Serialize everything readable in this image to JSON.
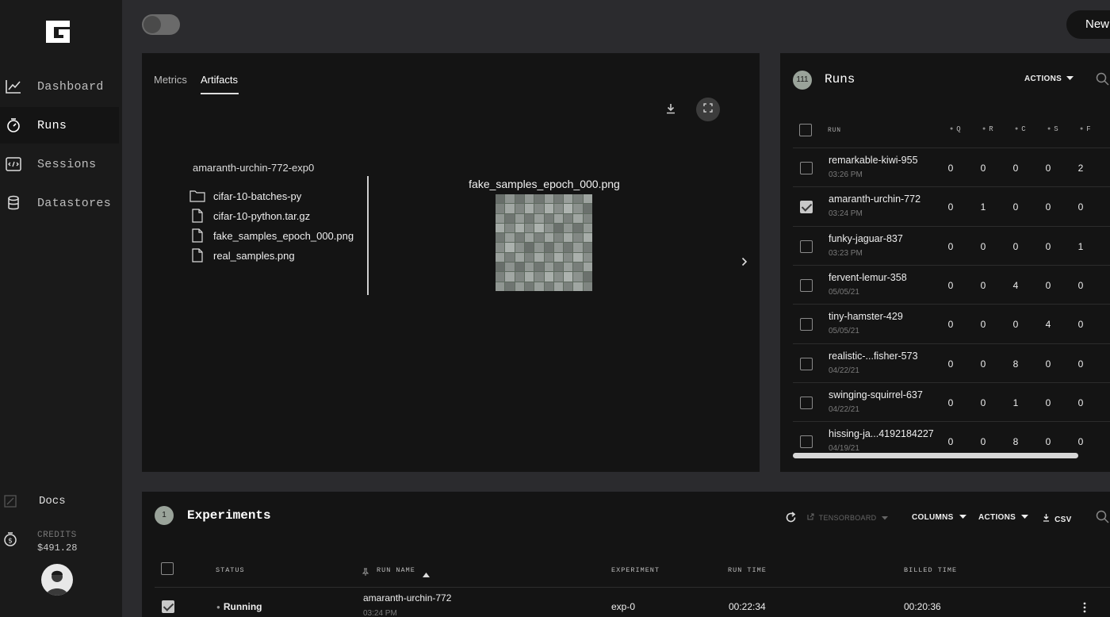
{
  "sidebar": {
    "items": [
      {
        "label": "Dashboard",
        "icon": "chart-line-icon",
        "active": false
      },
      {
        "label": "Runs",
        "icon": "stopwatch-icon",
        "active": true
      },
      {
        "label": "Sessions",
        "icon": "code-window-icon",
        "active": false
      },
      {
        "label": "Datastores",
        "icon": "database-icon",
        "active": false
      }
    ],
    "docs_label": "Docs",
    "credits_label": "CREDITS",
    "credits_value": "$491.28"
  },
  "topbar": {
    "new_label": "New"
  },
  "artifacts": {
    "tabs": [
      "Metrics",
      "Artifacts"
    ],
    "active_tab": "Artifacts",
    "tree_root": "amaranth-urchin-772-exp0",
    "files": [
      {
        "name": "cifar-10-batches-py",
        "type": "folder"
      },
      {
        "name": "cifar-10-python.tar.gz",
        "type": "file"
      },
      {
        "name": "fake_samples_epoch_000.png",
        "type": "file"
      },
      {
        "name": "real_samples.png",
        "type": "file"
      }
    ],
    "preview_title": "fake_samples_epoch_000.png"
  },
  "runs": {
    "count": "111",
    "title": "Runs",
    "actions_label": "ACTIONS",
    "headers": {
      "run": "RUN",
      "cols": [
        "Q",
        "R",
        "C",
        "S",
        "F"
      ]
    },
    "rows": [
      {
        "name": "remarkable-kiwi-955",
        "time": "03:26 PM",
        "checked": false,
        "vals": [
          "0",
          "0",
          "0",
          "0",
          "2"
        ]
      },
      {
        "name": "amaranth-urchin-772",
        "time": "03:24 PM",
        "checked": true,
        "vals": [
          "0",
          "1",
          "0",
          "0",
          "0"
        ]
      },
      {
        "name": "funky-jaguar-837",
        "time": "03:23 PM",
        "checked": false,
        "vals": [
          "0",
          "0",
          "0",
          "0",
          "1"
        ]
      },
      {
        "name": "fervent-lemur-358",
        "time": "05/05/21",
        "checked": false,
        "vals": [
          "0",
          "0",
          "4",
          "0",
          "0"
        ]
      },
      {
        "name": "tiny-hamster-429",
        "time": "05/05/21",
        "checked": false,
        "vals": [
          "0",
          "0",
          "0",
          "4",
          "0"
        ]
      },
      {
        "name": "realistic-...fisher-573",
        "time": "04/22/21",
        "checked": false,
        "vals": [
          "0",
          "0",
          "8",
          "0",
          "0"
        ]
      },
      {
        "name": "swinging-squirrel-637",
        "time": "04/22/21",
        "checked": false,
        "vals": [
          "0",
          "0",
          "1",
          "0",
          "0"
        ]
      },
      {
        "name": "hissing-ja...4192184227",
        "time": "04/19/21",
        "checked": false,
        "vals": [
          "0",
          "0",
          "8",
          "0",
          "0"
        ]
      }
    ]
  },
  "experiments": {
    "count": "1",
    "title": "Experiments",
    "tensorboard_label": "TENSORBOARD",
    "columns_label": "COLUMNS",
    "actions_label": "ACTIONS",
    "csv_label": "CSV",
    "headers": {
      "status": "STATUS",
      "run_name": "RUN NAME",
      "experiment": "EXPERIMENT",
      "run_time": "RUN TIME",
      "billed_time": "BILLED TIME"
    },
    "rows": [
      {
        "status": "Running",
        "run_name": "amaranth-urchin-772",
        "run_time_stamp": "03:24 PM",
        "experiment": "exp-0",
        "run_time": "00:22:34",
        "billed_time": "00:20:36",
        "checked": true
      }
    ]
  }
}
